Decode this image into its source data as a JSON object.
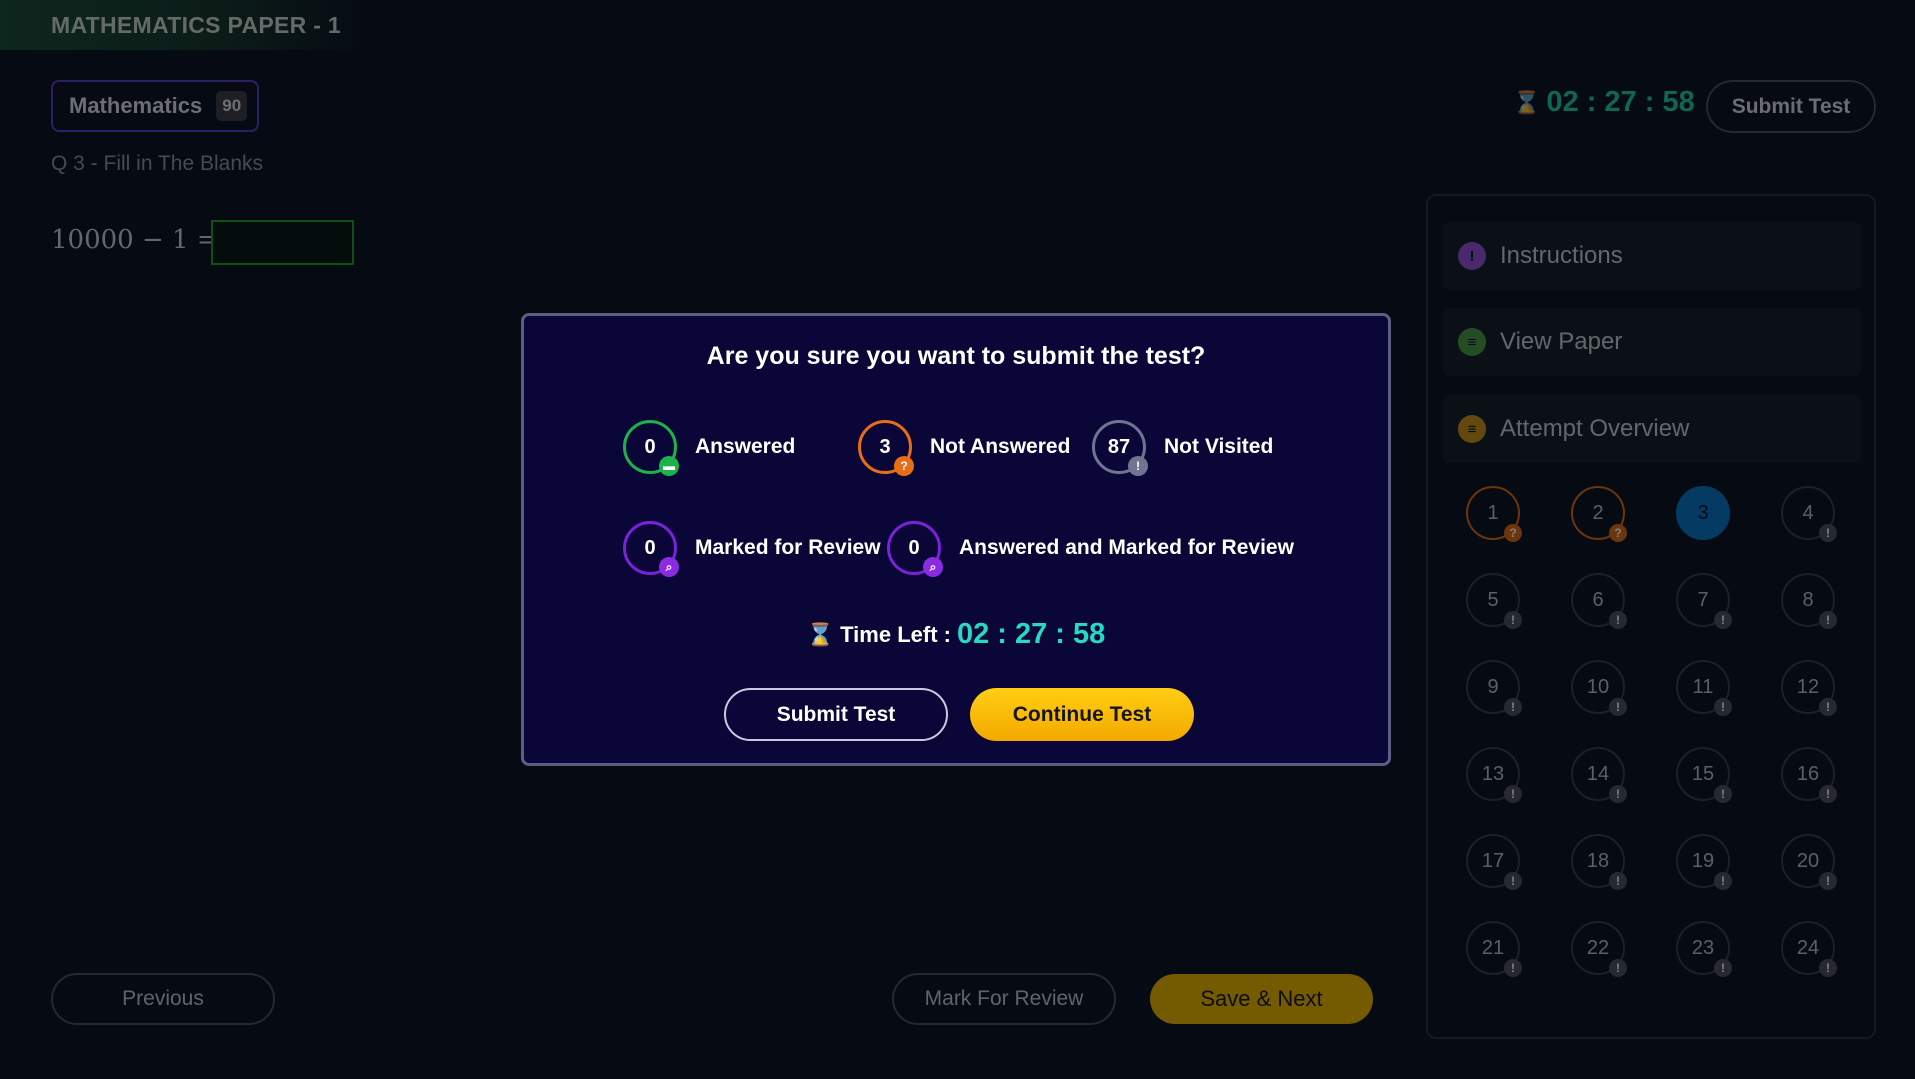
{
  "header": {
    "paper_title": "MATHEMATICS PAPER - 1"
  },
  "subject": {
    "name": "Mathematics",
    "count": "90"
  },
  "question": {
    "label": "Q 3 - Fill in The Blanks",
    "equation": "10000 − 1 ="
  },
  "top_bar": {
    "timer": "02 : 27 : 58",
    "submit_label": "Submit Test"
  },
  "side_panel": {
    "instructions": "Instructions",
    "view_paper": "View Paper",
    "attempt_overview": "Attempt Overview",
    "questions": [
      {
        "n": "1",
        "status": "not-answered"
      },
      {
        "n": "2",
        "status": "not-answered"
      },
      {
        "n": "3",
        "status": "current"
      },
      {
        "n": "4",
        "status": "not-visited"
      },
      {
        "n": "5",
        "status": "not-visited"
      },
      {
        "n": "6",
        "status": "not-visited"
      },
      {
        "n": "7",
        "status": "not-visited"
      },
      {
        "n": "8",
        "status": "not-visited"
      },
      {
        "n": "9",
        "status": "not-visited"
      },
      {
        "n": "10",
        "status": "not-visited"
      },
      {
        "n": "11",
        "status": "not-visited"
      },
      {
        "n": "12",
        "status": "not-visited"
      },
      {
        "n": "13",
        "status": "not-visited"
      },
      {
        "n": "14",
        "status": "not-visited"
      },
      {
        "n": "15",
        "status": "not-visited"
      },
      {
        "n": "16",
        "status": "not-visited"
      },
      {
        "n": "17",
        "status": "not-visited"
      },
      {
        "n": "18",
        "status": "not-visited"
      },
      {
        "n": "19",
        "status": "not-visited"
      },
      {
        "n": "20",
        "status": "not-visited"
      },
      {
        "n": "21",
        "status": "not-visited"
      },
      {
        "n": "22",
        "status": "not-visited"
      },
      {
        "n": "23",
        "status": "not-visited"
      },
      {
        "n": "24",
        "status": "not-visited"
      }
    ]
  },
  "footer": {
    "previous": "Previous",
    "mark_review": "Mark For Review",
    "save_next": "Save & Next"
  },
  "modal": {
    "title": "Are you sure you want to submit the test?",
    "answered": {
      "count": "0",
      "label": "Answered"
    },
    "not_answered": {
      "count": "3",
      "label": "Not Answered"
    },
    "not_visited": {
      "count": "87",
      "label": "Not Visited"
    },
    "marked_review": {
      "count": "0",
      "label": "Marked for Review"
    },
    "answered_marked": {
      "count": "0",
      "label": "Answered and Marked for Review"
    },
    "time_left_label": "Time Left :",
    "time_left_value": "02 : 27 : 58",
    "submit_label": "Submit Test",
    "continue_label": "Continue Test"
  },
  "colors": {
    "answered": "#1db34b",
    "not_answered": "#e86d16",
    "not_visited": "#6f7590",
    "marked": "#7a22d8",
    "timer": "#27d9c3",
    "continue_button": "#ffc107",
    "current_question": "#0a77c6"
  }
}
